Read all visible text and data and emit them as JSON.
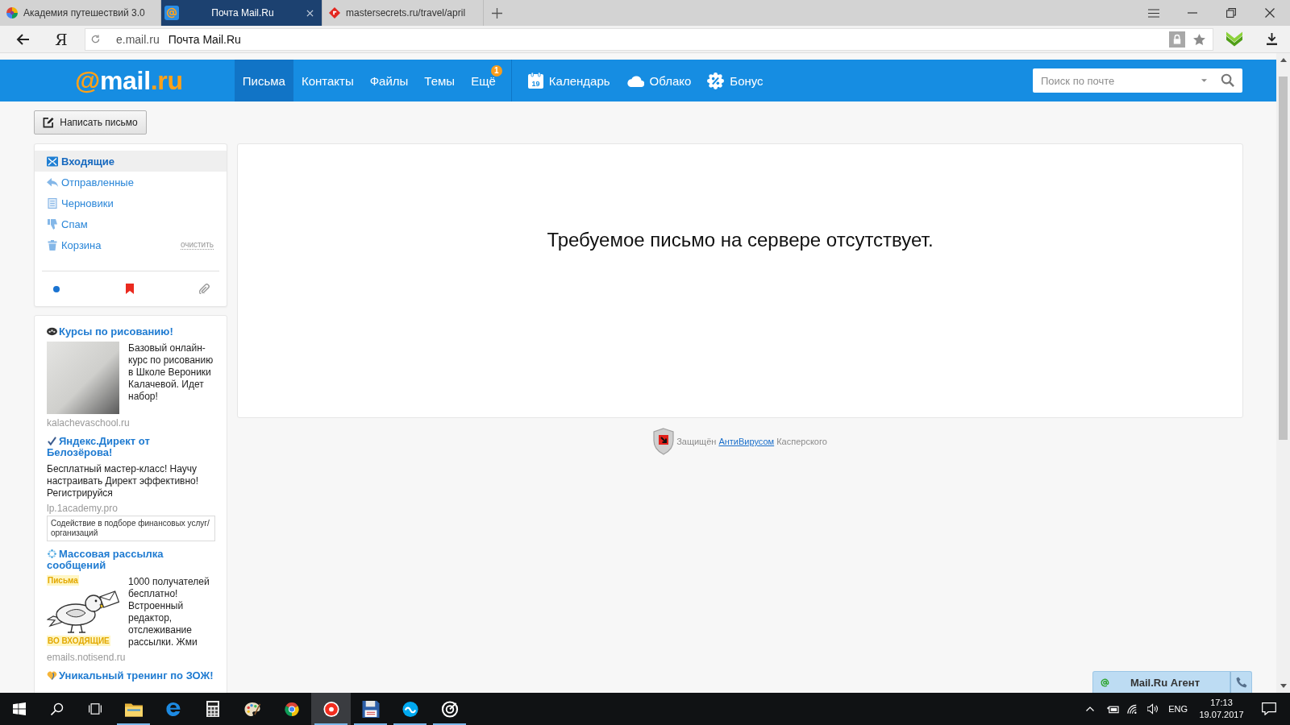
{
  "browser": {
    "tabs": [
      {
        "title": "Академия путешествий 3.0",
        "selected": false
      },
      {
        "title": "Почта Mail.Ru",
        "selected": true
      },
      {
        "title": "mastersecrets.ru/travel/april",
        "selected": false
      }
    ],
    "address": {
      "home_key": "Я",
      "domain": "e.mail.ru",
      "page_title": "Почта Mail.Ru"
    }
  },
  "header": {
    "logo": {
      "prefix": "@",
      "name": "mail",
      "suffix": ".ru"
    },
    "nav": [
      {
        "label": "Письма",
        "selected": true
      },
      {
        "label": "Контакты",
        "selected": false
      },
      {
        "label": "Файлы",
        "selected": false
      },
      {
        "label": "Темы",
        "selected": false
      },
      {
        "label": "Ещё",
        "selected": false,
        "badge": "1"
      }
    ],
    "services": [
      {
        "label": "Календарь",
        "icon_text": "19"
      },
      {
        "label": "Облако"
      },
      {
        "label": "Бонус"
      }
    ],
    "search": {
      "placeholder": "Поиск по почте"
    }
  },
  "sidebar": {
    "compose_button": "Написать письмо",
    "folders": [
      {
        "name": "Входящие",
        "selected": true
      },
      {
        "name": "Отправленные",
        "selected": false
      },
      {
        "name": "Черновики",
        "selected": false
      },
      {
        "name": "Спам",
        "selected": false
      },
      {
        "name": "Корзина",
        "selected": false,
        "action": "очистить"
      }
    ],
    "ads": [
      {
        "title": "Курсы по рисованию!",
        "image": {
          "kind": "photo"
        },
        "text": "Базовый онлайн-курс по рисованию в Школе Вероники Калачевой. Идет набор!",
        "domain": "kalachevaschool.ru"
      },
      {
        "title": "Яндекс.Директ от Белозёрова!",
        "text": "Бесплатный мастер-класс! Научу настраивать Директ эффективно! Регистрируйся",
        "domain": "lp.1academy.pro",
        "note": "Содействие в подборе финансовых услуг/организаций"
      },
      {
        "title": "Массовая рассылка сообщений",
        "image": {
          "kind": "illustration",
          "top_caption": "Письма",
          "bottom_caption": "ВО ВХОДЯЩИЕ"
        },
        "text": "1000 получателей бесплатно! Встроенный редактор, отслеживание рассылки. Жми",
        "domain": "emails.notisend.ru"
      },
      {
        "title": "Уникальный тренинг по ЗОЖ!"
      }
    ]
  },
  "main": {
    "message": "Требуемое письмо на сервере отсутствует.",
    "protection": {
      "before": "Защищён",
      "link": "АнтиВирусом",
      "after": "Касперского"
    }
  },
  "agent": {
    "label": "Mail.Ru Агент"
  },
  "taskbar": {
    "apps": [
      {
        "running": true,
        "selected": false
      },
      {
        "running": false,
        "selected": false
      },
      {
        "running": false,
        "selected": false
      },
      {
        "running": false,
        "selected": false
      },
      {
        "running": false,
        "selected": false
      },
      {
        "running": true,
        "selected": true
      },
      {
        "running": true,
        "selected": false
      },
      {
        "running": true,
        "selected": false
      },
      {
        "running": true,
        "selected": false
      }
    ],
    "tray": {
      "language": "ENG",
      "time": "17:13",
      "date": "19.07.2017"
    }
  }
}
